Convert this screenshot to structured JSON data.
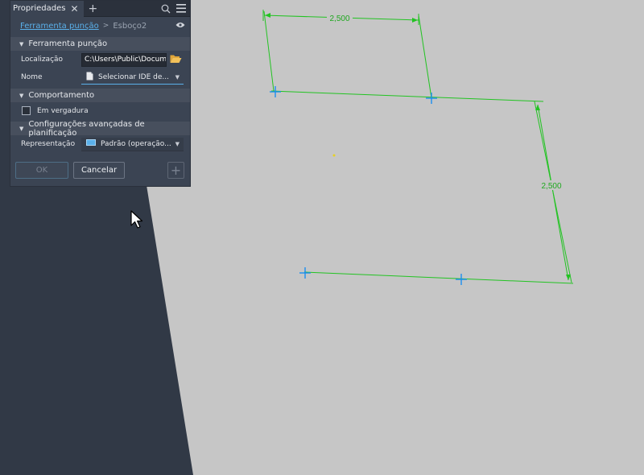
{
  "panel": {
    "tab_label": "Propriedades",
    "close_icon": "close-icon",
    "add_icon": "plus-icon",
    "breadcrumb": {
      "link": "Ferramenta punção",
      "separator": ">",
      "current": "Esboço2"
    },
    "sections": {
      "tool": "Ferramenta punção",
      "behavior": "Comportamento",
      "advanced": "Configurações avançadas de planificação"
    },
    "location": {
      "label": "Localização",
      "value": "C:\\Users\\Public\\Documents"
    },
    "name": {
      "label": "Nome",
      "value": "Selecionar IDE de..."
    },
    "in_bend": {
      "label": "Em vergadura",
      "checked": false
    },
    "representation": {
      "label": "Representação",
      "value": "Padrão (operação..."
    },
    "buttons": {
      "ok": "OK",
      "cancel": "Cancelar",
      "add": "+"
    }
  },
  "sketch": {
    "dimensions": [
      "2,500",
      "2,500"
    ],
    "colors": {
      "geometry": "#22c322",
      "points": "#1a8ef0",
      "center": "#e8d020",
      "background": "#c6c6c6",
      "dark_area": "#313946"
    }
  }
}
